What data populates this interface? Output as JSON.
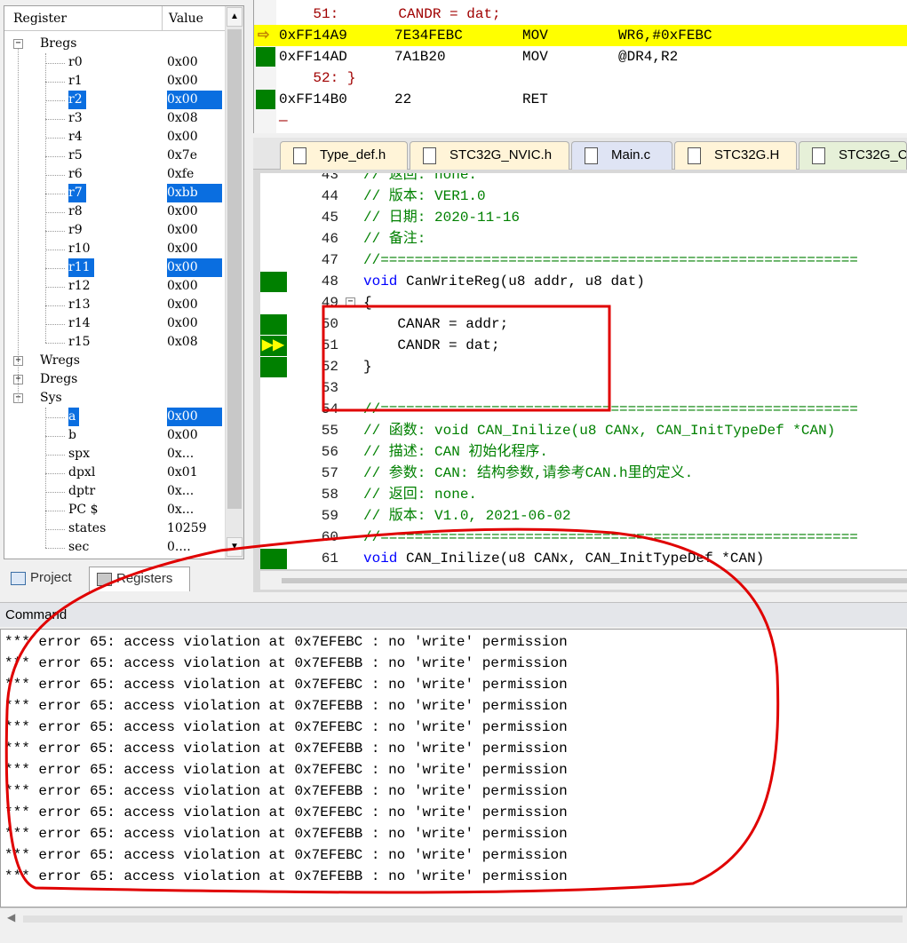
{
  "registers": {
    "header": {
      "name": "Register",
      "value": "Value"
    },
    "rows": [
      {
        "name": "Bregs",
        "value": "",
        "indent": 0,
        "group": true,
        "expanded": true,
        "sel": false
      },
      {
        "name": "r0",
        "value": "0x00",
        "indent": 1,
        "sel": false
      },
      {
        "name": "r1",
        "value": "0x00",
        "indent": 1,
        "sel": false
      },
      {
        "name": "r2",
        "value": "0x00",
        "indent": 1,
        "sel": true
      },
      {
        "name": "r3",
        "value": "0x08",
        "indent": 1,
        "sel": false
      },
      {
        "name": "r4",
        "value": "0x00",
        "indent": 1,
        "sel": false
      },
      {
        "name": "r5",
        "value": "0x7e",
        "indent": 1,
        "sel": false
      },
      {
        "name": "r6",
        "value": "0xfe",
        "indent": 1,
        "sel": false
      },
      {
        "name": "r7",
        "value": "0xbb",
        "indent": 1,
        "sel": true
      },
      {
        "name": "r8",
        "value": "0x00",
        "indent": 1,
        "sel": false
      },
      {
        "name": "r9",
        "value": "0x00",
        "indent": 1,
        "sel": false
      },
      {
        "name": "r10",
        "value": "0x00",
        "indent": 1,
        "sel": false
      },
      {
        "name": "r11",
        "value": "0x00",
        "indent": 1,
        "sel": true
      },
      {
        "name": "r12",
        "value": "0x00",
        "indent": 1,
        "sel": false
      },
      {
        "name": "r13",
        "value": "0x00",
        "indent": 1,
        "sel": false
      },
      {
        "name": "r14",
        "value": "0x00",
        "indent": 1,
        "sel": false
      },
      {
        "name": "r15",
        "value": "0x08",
        "indent": 1,
        "sel": false
      },
      {
        "name": "Wregs",
        "value": "",
        "indent": 0,
        "group": true,
        "expanded": false,
        "sel": false
      },
      {
        "name": "Dregs",
        "value": "",
        "indent": 0,
        "group": true,
        "expanded": false,
        "sel": false
      },
      {
        "name": "Sys",
        "value": "",
        "indent": 0,
        "group": true,
        "expanded": true,
        "sel": false
      },
      {
        "name": "a",
        "value": "0x00",
        "indent": 1,
        "sel": true
      },
      {
        "name": "b",
        "value": "0x00",
        "indent": 1,
        "sel": false
      },
      {
        "name": "spx",
        "value": "0x...",
        "indent": 1,
        "sel": false
      },
      {
        "name": "dpxl",
        "value": "0x01",
        "indent": 1,
        "sel": false
      },
      {
        "name": "dptr",
        "value": "0x...",
        "indent": 1,
        "sel": false
      },
      {
        "name": "PC  $",
        "value": "0x...",
        "indent": 1,
        "sel": false
      },
      {
        "name": "states",
        "value": "10259",
        "indent": 1,
        "sel": false
      },
      {
        "name": "sec",
        "value": "0....",
        "indent": 1,
        "sel": false
      }
    ]
  },
  "panel_tabs": {
    "project": "Project",
    "registers": "Registers"
  },
  "disassembly": [
    {
      "kind": "src",
      "text": "    51:       CANDR = dat;"
    },
    {
      "kind": "asm",
      "addr": "0xFF14A9",
      "bytes": "7E34FEBC",
      "op": "MOV",
      "args": "WR6,#0xFEBC",
      "current": true
    },
    {
      "kind": "asm",
      "addr": "0xFF14AD",
      "bytes": "7A1B20",
      "op": "MOV",
      "args": "@DR4,R2",
      "current": false
    },
    {
      "kind": "src",
      "text": "    52: }"
    },
    {
      "kind": "asm",
      "addr": "0xFF14B0",
      "bytes": "22",
      "op": "RET",
      "args": "",
      "current": false
    },
    {
      "kind": "src",
      "text": "—"
    }
  ],
  "file_tabs": [
    "Type_def.h",
    "STC32G_NVIC.h",
    "Main.c",
    "STC32G.H",
    "STC32G_C"
  ],
  "code": [
    {
      "ln": "43",
      "text": "// 返回: none."
    },
    {
      "ln": "44",
      "text": "// 版本: VER1.0"
    },
    {
      "ln": "45",
      "text": "// 日期: 2020-11-16"
    },
    {
      "ln": "46",
      "text": "// 备注:"
    },
    {
      "ln": "47",
      "text": "//========================================================"
    },
    {
      "ln": "48",
      "text": "void CanWriteReg(u8 addr, u8 dat)"
    },
    {
      "ln": "49",
      "text": "{"
    },
    {
      "ln": "50",
      "text": "    CANAR = addr;"
    },
    {
      "ln": "51",
      "text": "    CANDR = dat;"
    },
    {
      "ln": "52",
      "text": "}"
    },
    {
      "ln": "53",
      "text": ""
    },
    {
      "ln": "54",
      "text": "//========================================================"
    },
    {
      "ln": "55",
      "text": "// 函数: void CAN_Inilize(u8 CANx, CAN_InitTypeDef *CAN)"
    },
    {
      "ln": "56",
      "text": "// 描述: CAN 初始化程序."
    },
    {
      "ln": "57",
      "text": "// 参数: CAN: 结构参数,请参考CAN.h里的定义."
    },
    {
      "ln": "58",
      "text": "// 返回: none."
    },
    {
      "ln": "59",
      "text": "// 版本: V1.0, 2021-06-02"
    },
    {
      "ln": "60",
      "text": "//========================================================"
    },
    {
      "ln": "61",
      "text": "void CAN_Inilize(u8 CANx, CAN_InitTypeDef *CAN)"
    }
  ],
  "command": {
    "title": "Command",
    "lines": [
      "*** error 65: access violation at 0x7EFEBC : no 'write' permission",
      "*** error 65: access violation at 0x7EFEBB : no 'write' permission",
      "*** error 65: access violation at 0x7EFEBC : no 'write' permission",
      "*** error 65: access violation at 0x7EFEBB : no 'write' permission",
      "*** error 65: access violation at 0x7EFEBC : no 'write' permission",
      "*** error 65: access violation at 0x7EFEBB : no 'write' permission",
      "*** error 65: access violation at 0x7EFEBC : no 'write' permission",
      "*** error 65: access violation at 0x7EFEBB : no 'write' permission",
      "*** error 65: access violation at 0x7EFEBC : no 'write' permission",
      "*** error 65: access violation at 0x7EFEBB : no 'write' permission",
      "*** error 65: access violation at 0x7EFEBC : no 'write' permission",
      "*** error 65: access violation at 0x7EFEBB : no 'write' permission"
    ]
  },
  "colors": {
    "selection": "#0a6ee0",
    "current_line": "#ffff00",
    "gutter_mark": "#008000",
    "comment": "#008000",
    "keyword": "#0000ff",
    "annotation": "#e00000"
  }
}
